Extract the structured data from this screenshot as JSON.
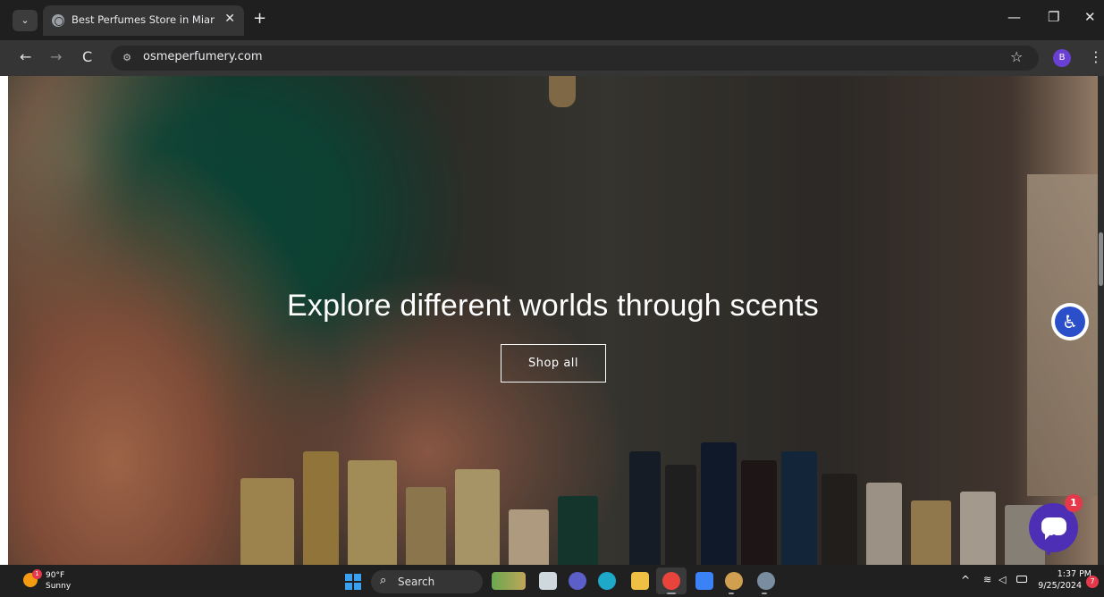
{
  "browser": {
    "tab_title": "Best Perfumes Store in Miami, FL |",
    "tab_close": "✕",
    "new_tab": "+",
    "url": "osmeperfumery.com",
    "profile_initial": "B",
    "tab_menu_icon": "chevron-down-icon",
    "window_controls": {
      "minimize": "—",
      "maximize": "❐",
      "close": "✕"
    },
    "nav": {
      "back": "←",
      "forward": "→",
      "reload": "C",
      "bookmark": "☆",
      "menu": "⋮",
      "site_info": "⚙"
    }
  },
  "hero": {
    "heading": "Explore different worlds through scents",
    "cta_label": "Shop all"
  },
  "widgets": {
    "accessibility_icon": "♿",
    "chat_badge_count": "1"
  },
  "taskbar": {
    "weather_temp": "90°F",
    "weather_desc": "Sunny",
    "weather_badge": "1",
    "search_label": "Search",
    "search_icon": "⌕",
    "tray_up": "^",
    "wifi_icon": "≋",
    "volume_icon": "◁",
    "time": "1:37 PM",
    "date": "9/25/2024",
    "notification_count": "7"
  },
  "colors": {
    "chrome_dark": "#1f1f1f",
    "chat_purple": "#4d2fb6",
    "accessibility_blue": "#2b4fc9",
    "badge_red": "#e5384b"
  }
}
